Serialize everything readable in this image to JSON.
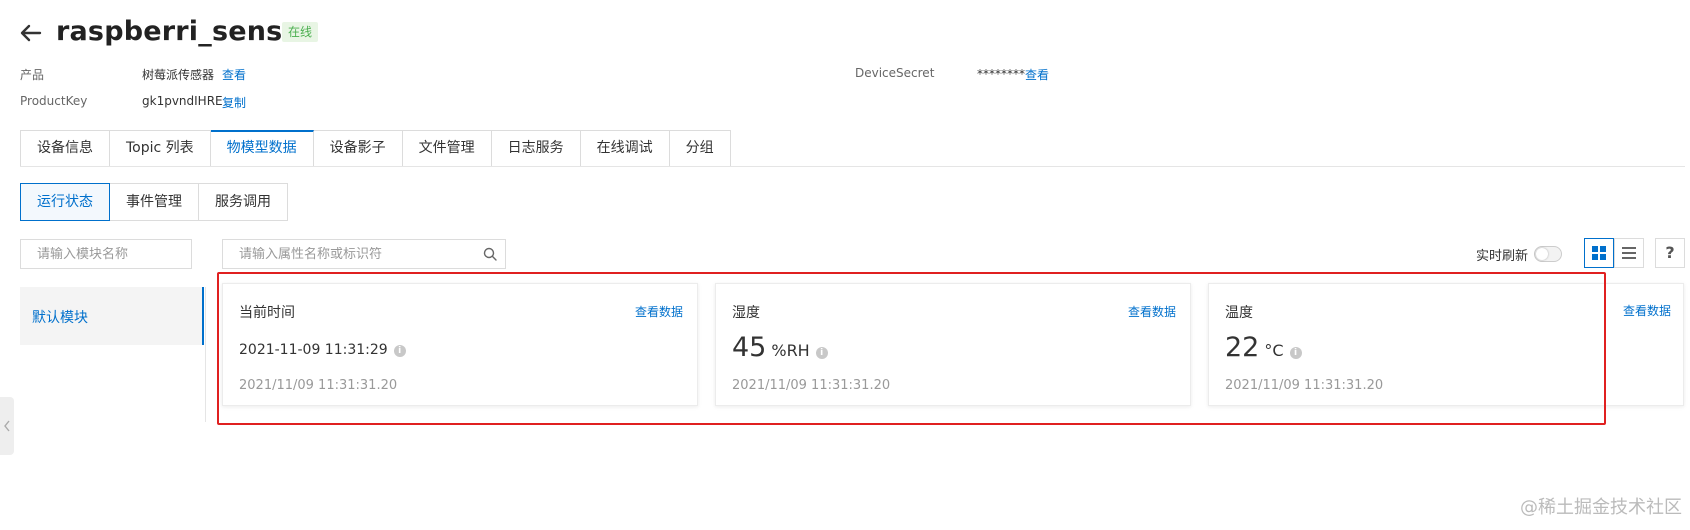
{
  "header": {
    "title": "raspberri_sensor",
    "status": "在线"
  },
  "meta": {
    "product_label": "产品",
    "product_value": "树莓派传感器",
    "product_link": "查看",
    "productkey_label": "ProductKey",
    "productkey_value": "gk1pvndIHRE",
    "productkey_link": "复制",
    "secret_label": "DeviceSecret",
    "secret_value": "********",
    "secret_link": "查看"
  },
  "tabs": [
    {
      "label": "设备信息",
      "active": false
    },
    {
      "label": "Topic 列表",
      "active": false
    },
    {
      "label": "物模型数据",
      "active": true
    },
    {
      "label": "设备影子",
      "active": false
    },
    {
      "label": "文件管理",
      "active": false
    },
    {
      "label": "日志服务",
      "active": false
    },
    {
      "label": "在线调试",
      "active": false
    },
    {
      "label": "分组",
      "active": false
    }
  ],
  "subtabs": [
    {
      "label": "运行状态",
      "active": true
    },
    {
      "label": "事件管理",
      "active": false
    },
    {
      "label": "服务调用",
      "active": false
    }
  ],
  "search": {
    "module_placeholder": "请输入模块名称",
    "property_placeholder": "请输入属性名称或标识符"
  },
  "toolbar": {
    "realtime_label": "实时刷新",
    "realtime_on": false,
    "help": "?"
  },
  "modules": [
    {
      "label": "默认模块",
      "active": true
    }
  ],
  "cards": [
    {
      "title": "当前时间",
      "link": "查看数据",
      "value": "2021-11-09 11:31:29",
      "unit": "",
      "time": "2021/11/09 11:31:31.20"
    },
    {
      "title": "湿度",
      "link": "查看数据",
      "value": "45",
      "unit": "%RH",
      "time": "2021/11/09 11:31:31.20"
    },
    {
      "title": "温度",
      "link": "查看数据",
      "value": "22",
      "unit": "°C",
      "time": "2021/11/09 11:31:31.20"
    }
  ],
  "overflow_link": "查看数据",
  "watermark": "@稀土掘金技术社区",
  "colors": {
    "accent": "#0070cc",
    "online": "#4caf50",
    "highlight": "#e02020"
  }
}
